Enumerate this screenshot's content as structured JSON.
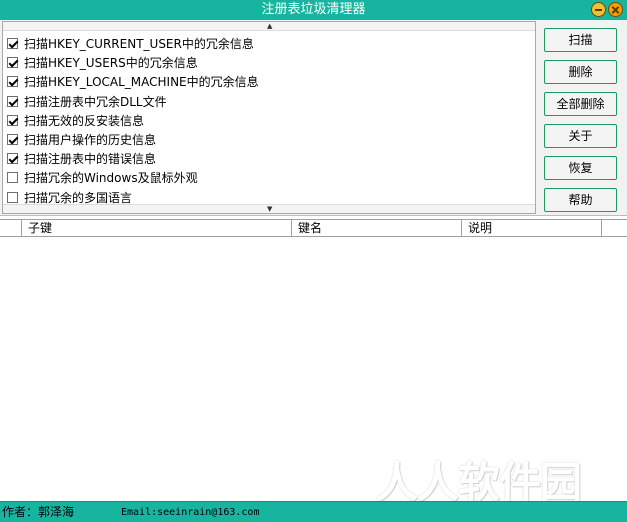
{
  "window": {
    "title": "注册表垃圾清理器",
    "controls": {
      "minimize_icon": "minimize-icon",
      "close_icon": "close-icon"
    }
  },
  "scan_options": [
    {
      "label": "扫描HKEY_CURRENT_USER中的冗余信息",
      "checked": true
    },
    {
      "label": "扫描HKEY_USERS中的冗余信息",
      "checked": true
    },
    {
      "label": "扫描HKEY_LOCAL_MACHINE中的冗余信息",
      "checked": true
    },
    {
      "label": "扫描注册表中冗余DLL文件",
      "checked": true
    },
    {
      "label": "扫描无效的反安装信息",
      "checked": true
    },
    {
      "label": "扫描用户操作的历史信息",
      "checked": true
    },
    {
      "label": "扫描注册表中的错误信息",
      "checked": true
    },
    {
      "label": "扫描冗余的Windows及鼠标外观",
      "checked": false
    },
    {
      "label": "扫描冗余的多国语言",
      "checked": false
    }
  ],
  "buttons": {
    "scan": "扫描",
    "delete": "删除",
    "delete_all": "全部删除",
    "about": "关于",
    "restore": "恢复",
    "help": "帮助"
  },
  "table": {
    "columns": [
      "子键",
      "键名",
      "说明"
    ],
    "rows": []
  },
  "status": {
    "author": "作者：郭泽海",
    "email": "Email:seeinrain@163.com"
  },
  "watermark": "人人软件园",
  "colors": {
    "accent": "#17b5a0",
    "button_border": "#1d9a60"
  }
}
